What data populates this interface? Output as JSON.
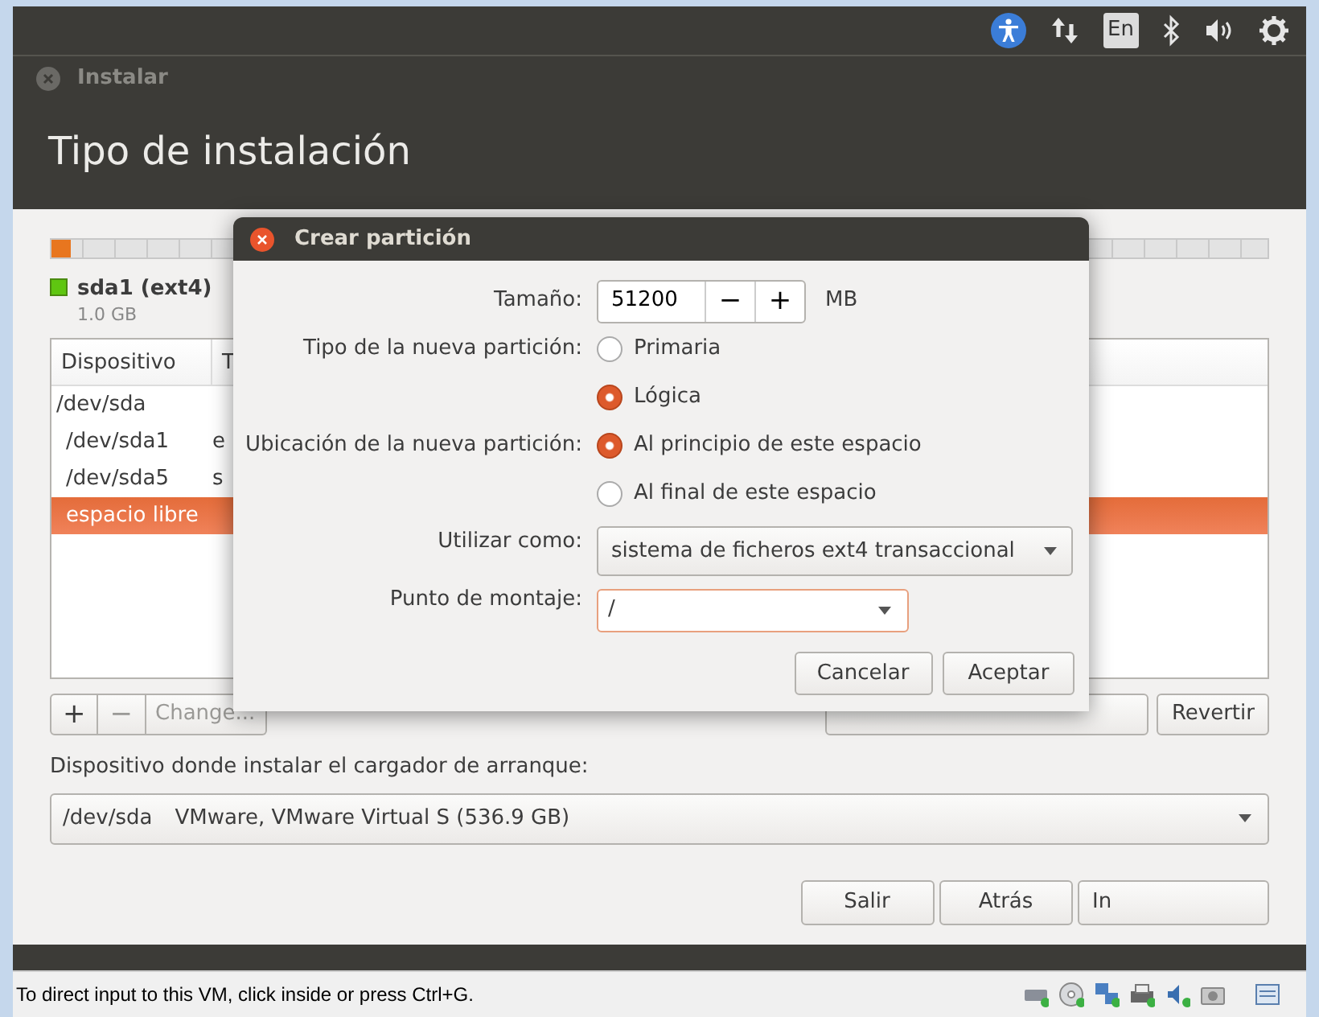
{
  "top_panel": {
    "keyboard_layout": "En"
  },
  "window": {
    "title": "Instalar",
    "heading": "Tipo de instalación"
  },
  "partition_bar": {
    "segments": [
      {
        "color": "#e8761f",
        "level": 0.016
      }
    ]
  },
  "legend": [
    {
      "name": "sda1 (ext4)",
      "size": "1.0 GB",
      "color": "#5fc611"
    }
  ],
  "table": {
    "columns": [
      "Dispositivo",
      "T"
    ],
    "rows": [
      {
        "device": "/dev/sda",
        "selected": false,
        "children": [
          {
            "device": "/dev/sda1",
            "column_2": "e",
            "selected": false
          },
          {
            "device": "/dev/sda5",
            "column_2": "s",
            "selected": false
          },
          {
            "device": "espacio libre",
            "selected": true
          }
        ]
      }
    ]
  },
  "toolbar": [
    {
      "label": "+",
      "disabled": false
    },
    {
      "label": "−",
      "disabled": true
    },
    {
      "label": "Change...",
      "disabled": true
    }
  ],
  "revert_button": "Revertir",
  "bootloader": {
    "label": "Dispositivo donde instalar el cargador de arranque:",
    "device": "/dev/sda",
    "description": "VMware, VMware Virtual S (536.9 GB)"
  },
  "nav_buttons": [
    "Salir",
    "Atrás",
    "In"
  ],
  "dialog": {
    "title": "Crear partición",
    "size": {
      "label": "Tamaño:",
      "value": "51200",
      "decrement": "−",
      "increment": "+",
      "unit": "MB"
    },
    "radio_groups": [
      {
        "label": "Tipo de la nueva partición:",
        "options": [
          {
            "label": "Primaria",
            "selected": false
          },
          {
            "label": "Lógica",
            "selected": true
          }
        ]
      },
      {
        "label": "Ubicación de la nueva partición:",
        "options": [
          {
            "label": "Al principio de este espacio",
            "selected": true
          },
          {
            "label": "Al final de este espacio",
            "selected": false
          }
        ]
      }
    ],
    "use_as": {
      "label": "Utilizar como:",
      "value": "sistema de ficheros ext4 transaccional"
    },
    "mount_point": {
      "label": "Punto de montaje:",
      "value": "/"
    },
    "buttons": [
      "Cancelar",
      "Aceptar"
    ]
  },
  "status_bar": "To direct input to this VM, click inside or press Ctrl+G."
}
